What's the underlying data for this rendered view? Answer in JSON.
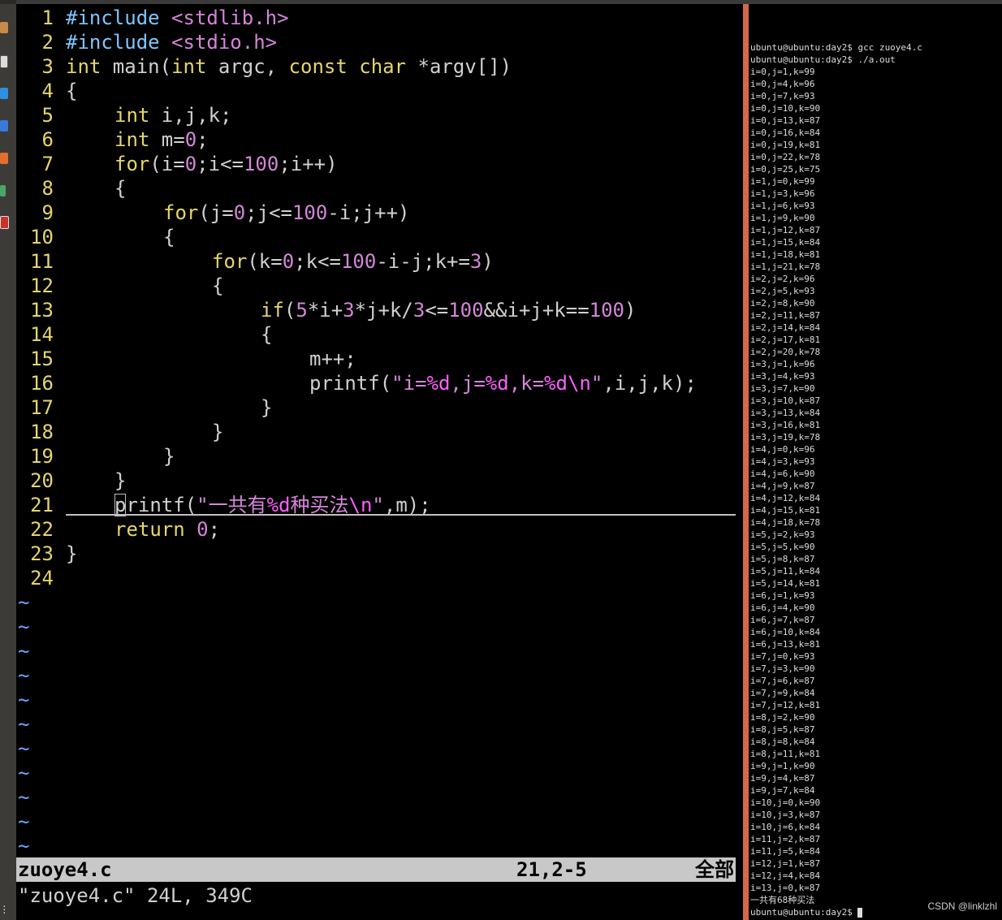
{
  "vim": {
    "lines": [
      {
        "n": "1"
      },
      {
        "n": "2"
      },
      {
        "n": "3"
      },
      {
        "n": "4"
      },
      {
        "n": "5"
      },
      {
        "n": "6"
      },
      {
        "n": "7"
      },
      {
        "n": "8"
      },
      {
        "n": "9"
      },
      {
        "n": "10"
      },
      {
        "n": "11"
      },
      {
        "n": "12"
      },
      {
        "n": "13"
      },
      {
        "n": "14"
      },
      {
        "n": "15"
      },
      {
        "n": "16"
      },
      {
        "n": "17"
      },
      {
        "n": "18"
      },
      {
        "n": "19"
      },
      {
        "n": "20"
      },
      {
        "n": "21"
      },
      {
        "n": "22"
      },
      {
        "n": "23"
      },
      {
        "n": "24"
      }
    ],
    "code": {
      "l1_a": "#include ",
      "l1_b": "<stdlib.h>",
      "l2_a": "#include ",
      "l2_b": "<stdio.h>",
      "l3_a": "int",
      "l3_b": " main(",
      "l3_c": "int",
      "l3_d": " argc, ",
      "l3_e": "const",
      "l3_f": " ",
      "l3_g": "char",
      "l3_h": " *argv[])",
      "l4": "{",
      "l5_a": "int",
      "l5_b": " i,j,k;",
      "l6_a": "int",
      "l6_b": " m=",
      "l6_c": "0",
      "l6_d": ";",
      "l7_a": "for",
      "l7_b": "(i=",
      "l7_c": "0",
      "l7_d": ";i<=",
      "l7_e": "100",
      "l7_f": ";i++)",
      "l8": "{",
      "l9_a": "for",
      "l9_b": "(j=",
      "l9_c": "0",
      "l9_d": ";j<=",
      "l9_e": "100",
      "l9_f": "-i;j++)",
      "l10": "{",
      "l11_a": "for",
      "l11_b": "(k=",
      "l11_c": "0",
      "l11_d": ";k<=",
      "l11_e": "100",
      "l11_f": "-i-j;k+=",
      "l11_g": "3",
      "l11_h": ")",
      "l12": "{",
      "l13_a": "if",
      "l13_b": "(",
      "l13_c": "5",
      "l13_d": "*i+",
      "l13_e": "3",
      "l13_f": "*j+k/",
      "l13_g": "3",
      "l13_h": "<=",
      "l13_i": "100",
      "l13_j": "&&i+j+k==",
      "l13_k": "100",
      "l13_l": ")",
      "l14": "{",
      "l15": "m++;",
      "l16_a": "printf(",
      "l16_b": "\"i=",
      "l16_c": "%d",
      "l16_d": ",j=",
      "l16_e": "%d",
      "l16_f": ",k=",
      "l16_g": "%d",
      "l16_h": "\\n",
      "l16_i": "\"",
      "l16_j": ",i,j,k);",
      "l17": "}",
      "l18": "}",
      "l19": "}",
      "l20": "}",
      "l21_a": "printf(",
      "l21_b": "\"一共有",
      "l21_c": "%d",
      "l21_d": "种买法",
      "l21_e": "\\n",
      "l21_f": "\"",
      "l21_g": ",m);",
      "l22_a": "return",
      "l22_b": " ",
      "l22_c": "0",
      "l22_d": ";",
      "l23": "}"
    },
    "tilde": "~",
    "status": {
      "filename": "zuoye4.c",
      "position": "21,2-5",
      "scroll": "全部"
    },
    "message": "\"zuoye4.c\" 24L, 349C"
  },
  "terminal": {
    "lines": [
      "ubuntu@ubuntu:day2$ gcc zuoye4.c",
      "ubuntu@ubuntu:day2$ ./a.out",
      "i=0,j=1,k=99",
      "i=0,j=4,k=96",
      "i=0,j=7,k=93",
      "i=0,j=10,k=90",
      "i=0,j=13,k=87",
      "i=0,j=16,k=84",
      "i=0,j=19,k=81",
      "i=0,j=22,k=78",
      "i=0,j=25,k=75",
      "i=1,j=0,k=99",
      "i=1,j=3,k=96",
      "i=1,j=6,k=93",
      "i=1,j=9,k=90",
      "i=1,j=12,k=87",
      "i=1,j=15,k=84",
      "i=1,j=18,k=81",
      "i=1,j=21,k=78",
      "i=2,j=2,k=96",
      "i=2,j=5,k=93",
      "i=2,j=8,k=90",
      "i=2,j=11,k=87",
      "i=2,j=14,k=84",
      "i=2,j=17,k=81",
      "i=2,j=20,k=78",
      "i=3,j=1,k=96",
      "i=3,j=4,k=93",
      "i=3,j=7,k=90",
      "i=3,j=10,k=87",
      "i=3,j=13,k=84",
      "i=3,j=16,k=81",
      "i=3,j=19,k=78",
      "i=4,j=0,k=96",
      "i=4,j=3,k=93",
      "i=4,j=6,k=90",
      "i=4,j=9,k=87",
      "i=4,j=12,k=84",
      "i=4,j=15,k=81",
      "i=4,j=18,k=78",
      "i=5,j=2,k=93",
      "i=5,j=5,k=90",
      "i=5,j=8,k=87",
      "i=5,j=11,k=84",
      "i=5,j=14,k=81",
      "i=6,j=1,k=93",
      "i=6,j=4,k=90",
      "i=6,j=7,k=87",
      "i=6,j=10,k=84",
      "i=6,j=13,k=81",
      "i=7,j=0,k=93",
      "i=7,j=3,k=90",
      "i=7,j=6,k=87",
      "i=7,j=9,k=84",
      "i=7,j=12,k=81",
      "i=8,j=2,k=90",
      "i=8,j=5,k=87",
      "i=8,j=8,k=84",
      "i=8,j=11,k=81",
      "i=9,j=1,k=90",
      "i=9,j=4,k=87",
      "i=9,j=7,k=84",
      "i=10,j=0,k=90",
      "i=10,j=3,k=87",
      "i=10,j=6,k=84",
      "i=11,j=2,k=87",
      "i=11,j=5,k=84",
      "i=12,j=1,k=87",
      "i=12,j=4,k=84",
      "i=13,j=0,k=87",
      "一共有68种买法",
      "ubuntu@ubuntu:day2$ "
    ],
    "watermark": "CSDN @linklzhl"
  },
  "colors": {
    "divider": "#d4694a",
    "keyword": "#e5d66b",
    "preproc": "#7fc5ff",
    "string": "#d486d8",
    "special": "#ff5fff"
  },
  "dock_icons": [
    "files-icon",
    "terminal-icon",
    "vscode-icon",
    "text-editor-icon",
    "software-icon",
    "maps-icon",
    "app-icon"
  ]
}
